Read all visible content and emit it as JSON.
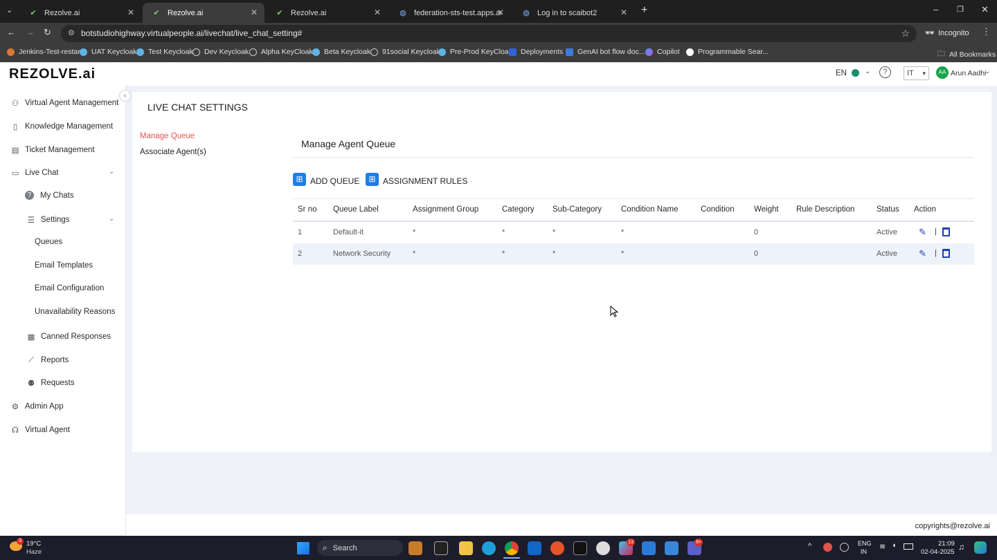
{
  "browser": {
    "tabs": [
      {
        "title": "Rezolve.ai"
      },
      {
        "title": "Rezolve.ai"
      },
      {
        "title": "Rezolve.ai"
      },
      {
        "title": "federation-sts-test.apps.actionabl"
      },
      {
        "title": "Log in to scaibot2"
      }
    ],
    "url": "botstudiohighway.virtualpeople.ai/livechat/live_chat_setting#",
    "mode_label": "Incognito",
    "bookmarks": [
      "Jenkins-Test-restart",
      "UAT Keycloak",
      "Test Keycloak",
      "Dev Keycloak",
      "Alpha KeyCloak",
      "Beta Keycloak",
      "91social Keycloak",
      "Pre-Prod KeyCloak",
      "Deployments",
      "GenAI bot flow doc...",
      "Copilot",
      "Programmable Sear..."
    ],
    "all_bookmarks_label": "All Bookmarks"
  },
  "header": {
    "logo_text": "REZOLVE.ai",
    "language": "EN",
    "department": "IT",
    "avatar_initials": "AA",
    "user_name": "Arun Aadhi"
  },
  "sidebar": {
    "items": [
      {
        "label": "Virtual Agent Management",
        "icon": "people-icon"
      },
      {
        "label": "Knowledge Management",
        "icon": "book-icon"
      },
      {
        "label": "Ticket Management",
        "icon": "ticket-icon"
      },
      {
        "label": "Live Chat",
        "icon": "chat-icon"
      },
      {
        "label": "My Chats",
        "icon": "help-icon"
      },
      {
        "label": "Settings",
        "icon": "settings-icon"
      },
      {
        "label": "Queues"
      },
      {
        "label": "Email Templates"
      },
      {
        "label": "Email Configuration"
      },
      {
        "label": "Unavailability Reasons"
      },
      {
        "label": "Canned Responses",
        "icon": "canned-icon"
      },
      {
        "label": "Reports",
        "icon": "reports-icon"
      },
      {
        "label": "Requests",
        "icon": "requests-icon"
      },
      {
        "label": "Admin App",
        "icon": "admin-icon"
      },
      {
        "label": "Virtual Agent",
        "icon": "agent-icon"
      }
    ]
  },
  "main": {
    "page_title": "LIVE CHAT SETTINGS",
    "subnav": [
      "Manage Queue",
      "Associate Agent(s)"
    ],
    "section_title": "Manage Agent Queue",
    "add_queue_label": "ADD QUEUE",
    "assignment_rules_label": "ASSIGNMENT RULES",
    "columns": [
      "Sr no",
      "Queue Label",
      "Assignment Group",
      "Category",
      "Sub-Category",
      "Condition Name",
      "Condition",
      "Weight",
      "Rule Description",
      "Status",
      "Action"
    ],
    "rows": [
      {
        "sr": "1",
        "label": "Default-it",
        "group": "*",
        "category": "*",
        "subcategory": "*",
        "condition_name": "*",
        "condition": "",
        "weight": "0",
        "description": "",
        "status": "Active"
      },
      {
        "sr": "2",
        "label": "Network Security",
        "group": "*",
        "category": "*",
        "subcategory": "*",
        "condition_name": "*",
        "condition": "",
        "weight": "0",
        "description": "",
        "status": "Active"
      }
    ],
    "action_separator": "|"
  },
  "footer": {
    "copyright": "copyrights@rezolve.ai"
  },
  "taskbar": {
    "weather_temp": "19°C",
    "weather_desc": "Haze",
    "weather_badge": "3",
    "search_label": "Search",
    "lang_top": "ENG",
    "lang_bottom": "IN",
    "time": "21:09",
    "date": "02-04-2025",
    "badge_1": "13",
    "badge_2": "9+"
  },
  "colors": {
    "accent_blue": "#1e7ee6",
    "active_link": "#e8534f",
    "edit_icon": "#1a3fb0",
    "delete_icon": "#1a3fb0"
  }
}
